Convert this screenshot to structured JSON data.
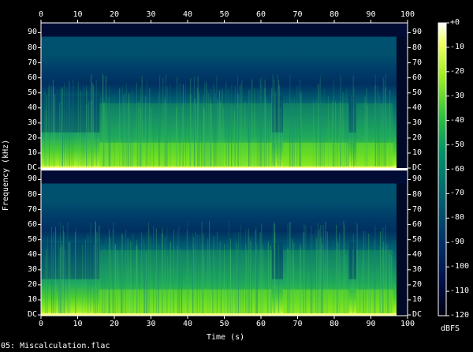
{
  "filename": "05: Miscalculation.flac",
  "x_axis": {
    "label": "Time (s)",
    "ticks": [
      "0",
      "10",
      "20",
      "30",
      "40",
      "50",
      "60",
      "70",
      "80",
      "90",
      "100"
    ],
    "range": [
      0,
      100
    ]
  },
  "y_axis": {
    "label": "Frequency (kHz)",
    "ticks": [
      "DC",
      "10",
      "20",
      "30",
      "40",
      "50",
      "60",
      "70",
      "80",
      "90"
    ],
    "range_khz": [
      0,
      96
    ]
  },
  "colorbar": {
    "label": "dBFS",
    "ticks": [
      "+0",
      "-10",
      "-20",
      "-30",
      "-40",
      "-50",
      "-60",
      "-70",
      "-80",
      "-90",
      "-100",
      "-110",
      "-120"
    ],
    "range_db": [
      -120,
      0
    ],
    "colors": [
      "#000010",
      "#00104a",
      "#00306a",
      "#00606f",
      "#00906a",
      "#30c040",
      "#a0f020",
      "#f0ff60",
      "#ffffff"
    ]
  },
  "chart_data": {
    "type": "heatmap",
    "channels": 2,
    "xlabel": "Time (s)",
    "ylabel": "Frequency (kHz)",
    "xlim": [
      0,
      100
    ],
    "ylim": [
      0,
      96
    ],
    "zlim": [
      -120,
      0
    ],
    "zlabel": "dBFS",
    "bandwidth_cutoff_khz": 87,
    "audio_end_s": 97,
    "segment_boundaries_s": [
      16,
      63,
      66,
      84,
      86
    ]
  }
}
